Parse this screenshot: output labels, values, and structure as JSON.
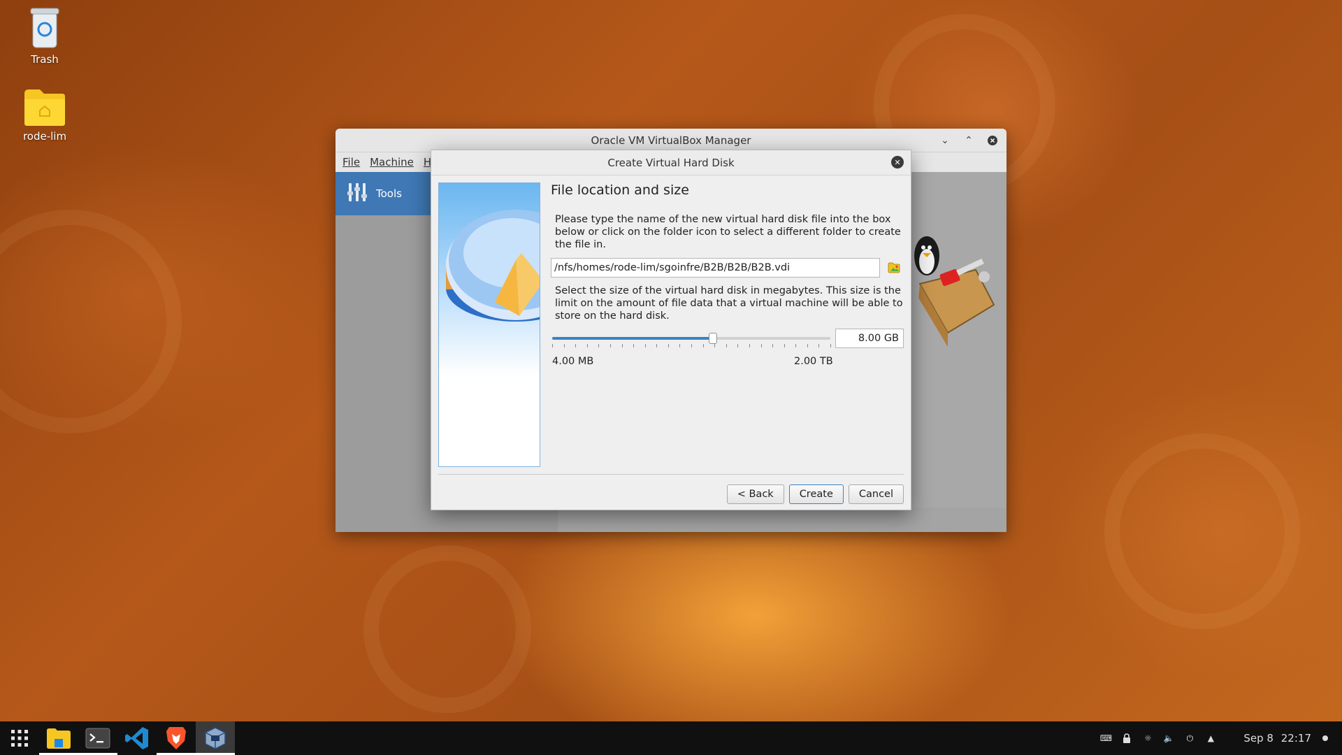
{
  "desktop": {
    "icons": [
      {
        "label": "Trash",
        "icon": "trash-icon"
      },
      {
        "label": "rode-lim",
        "icon": "home-folder-icon"
      }
    ]
  },
  "manager": {
    "title": "Oracle VM VirtualBox Manager",
    "menu": [
      "File",
      "Machine",
      "He"
    ],
    "tools_label": "Tools"
  },
  "dialog": {
    "title": "Create Virtual Hard Disk",
    "heading": "File location and size",
    "location_text": "Please type the name of the new virtual hard disk file into the box below or click on the folder icon to select a different folder to create the file in.",
    "file_path": "/nfs/homes/rode-lim/sgoinfre/B2B/B2B/B2B.vdi",
    "size_text": "Select the size of the virtual hard disk in megabytes. This size is the limit on the amount of file data that a virtual machine will be able to store on the hard disk.",
    "size_value": "8.00 GB",
    "slider_fraction": 0.577,
    "min_label": "4.00 MB",
    "max_label": "2.00 TB",
    "buttons": {
      "back": "Back",
      "back_prefix": "< ",
      "create": "Create",
      "cancel": "Cancel"
    }
  },
  "taskbar": {
    "apps": [
      "app-grid-icon",
      "files-icon",
      "terminal-icon",
      "vscode-icon",
      "brave-icon",
      "virtualbox-icon"
    ],
    "clock_date": "Sep 8",
    "clock_time": "22:17"
  },
  "colors": {
    "accent": "#3b82c4",
    "tools_bg": "#3f78b4",
    "taskbar": "#101010"
  }
}
